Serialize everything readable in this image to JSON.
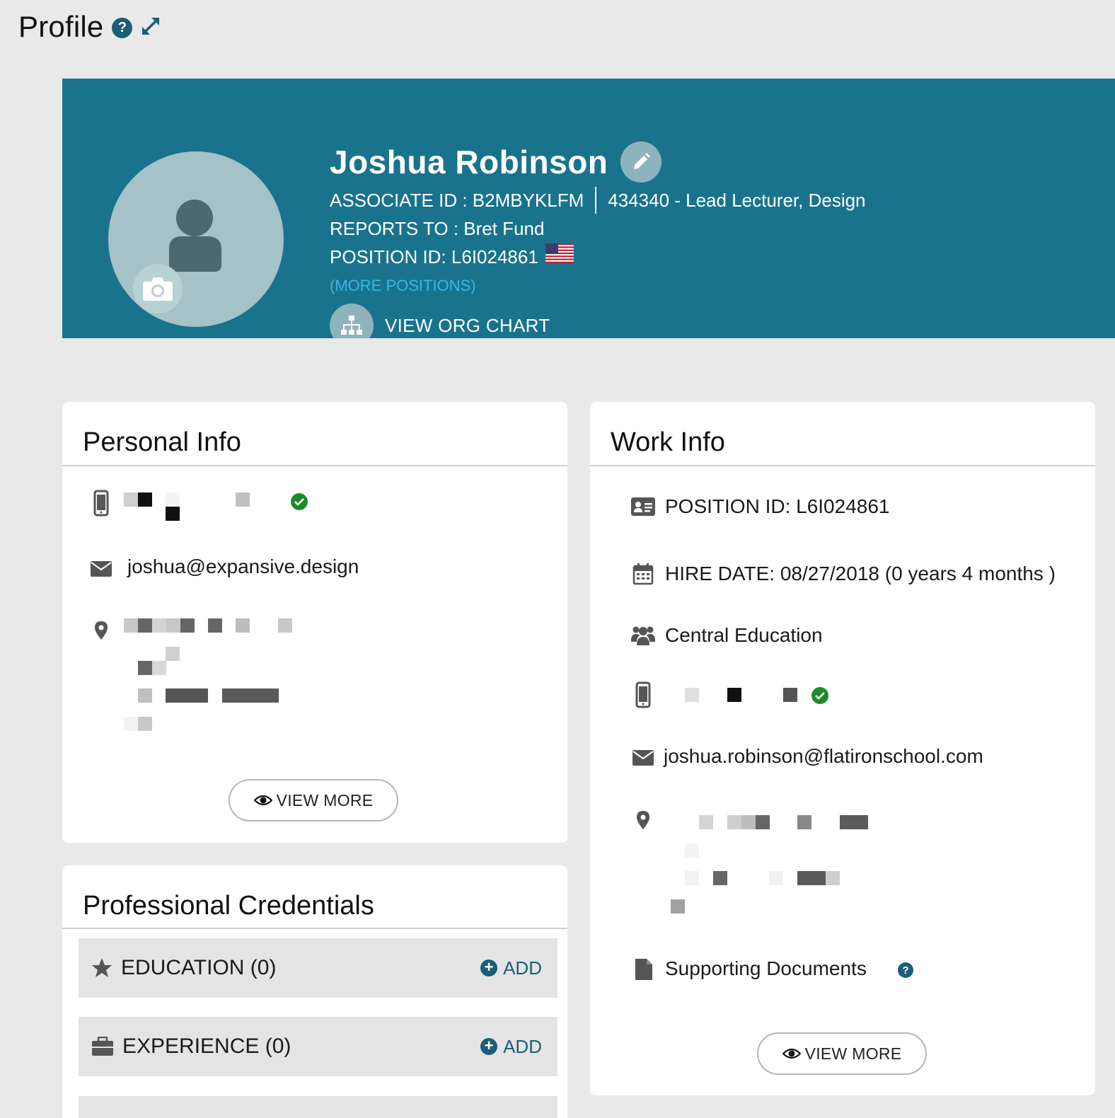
{
  "page": {
    "title": "Profile"
  },
  "banner": {
    "name": "Joshua Robinson",
    "associate_id": "ASSOCIATE ID : B2MBYKLFM",
    "job": "434340 - Lead Lecturer, Design",
    "reports_to": "REPORTS TO : Bret Fund",
    "position_id": "POSITION ID: L6I024861",
    "more_positions": "(MORE POSITIONS)",
    "org_chart": "VIEW ORG CHART"
  },
  "personal_info": {
    "title": "Personal Info",
    "email": "joshua@expansive.design",
    "view_more": "VIEW MORE"
  },
  "credentials": {
    "title": "Professional Credentials",
    "items": [
      {
        "label": "EDUCATION (0)",
        "add": "ADD"
      },
      {
        "label": "EXPERIENCE (0)",
        "add": "ADD"
      }
    ]
  },
  "work_info": {
    "title": "Work Info",
    "position_id": "POSITION ID: L6I024861",
    "hire_date": "HIRE DATE: 08/27/2018 (0 years 4 months )",
    "department": "Central Education",
    "email": "joshua.robinson@flatironschool.com",
    "supporting_docs": "Supporting Documents",
    "view_more": "VIEW MORE"
  },
  "colors": {
    "banner": "#1a738c",
    "accent": "#1b5e77",
    "link": "#34b8ea",
    "verified": "#1c8a2a"
  }
}
